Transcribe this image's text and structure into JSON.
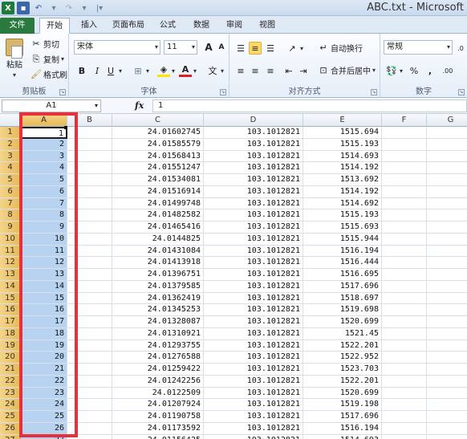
{
  "window": {
    "title": "ABC.txt - Microsoft"
  },
  "ribbon": {
    "tabs": [
      "文件",
      "开始",
      "插入",
      "页面布局",
      "公式",
      "数据",
      "审阅",
      "视图"
    ],
    "active_tab": "开始",
    "clipboard": {
      "paste": "粘贴",
      "cut": "剪切",
      "copy": "复制",
      "format_painter": "格式刷",
      "label": "剪贴板"
    },
    "font": {
      "name": "宋体",
      "size": "11",
      "bold": "B",
      "italic": "I",
      "underline": "U",
      "grow": "A",
      "shrink": "A",
      "font_color": "A",
      "phonetic": "文",
      "label": "字体"
    },
    "alignment": {
      "wrap_text": "自动换行",
      "merge_center": "合并后居中",
      "label": "对齐方式"
    },
    "number": {
      "format": "常规",
      "percent": "%",
      "comma": ",",
      "label": "数字"
    }
  },
  "formula_bar": {
    "name_box": "A1",
    "fx": "fx",
    "value": "1"
  },
  "grid": {
    "columns": [
      "A",
      "B",
      "C",
      "D",
      "E",
      "F",
      "G"
    ],
    "selected_column": "A",
    "active_cell": "A1",
    "rows": [
      [
        "1",
        "1",
        "",
        "24.01602745",
        "103.1012821",
        "1515.694"
      ],
      [
        "2",
        "2",
        "",
        "24.01585579",
        "103.1012821",
        "1515.193"
      ],
      [
        "3",
        "3",
        "",
        "24.01568413",
        "103.1012821",
        "1514.693"
      ],
      [
        "4",
        "4",
        "",
        "24.01551247",
        "103.1012821",
        "1514.192"
      ],
      [
        "5",
        "5",
        "",
        "24.01534081",
        "103.1012821",
        "1513.692"
      ],
      [
        "6",
        "6",
        "",
        "24.01516914",
        "103.1012821",
        "1514.192"
      ],
      [
        "7",
        "7",
        "",
        "24.01499748",
        "103.1012821",
        "1514.692"
      ],
      [
        "8",
        "8",
        "",
        "24.01482582",
        "103.1012821",
        "1515.193"
      ],
      [
        "9",
        "9",
        "",
        "24.01465416",
        "103.1012821",
        "1515.693"
      ],
      [
        "10",
        "10",
        "",
        "24.0144825",
        "103.1012821",
        "1515.944"
      ],
      [
        "11",
        "11",
        "",
        "24.01431084",
        "103.1012821",
        "1516.194"
      ],
      [
        "12",
        "12",
        "",
        "24.01413918",
        "103.1012821",
        "1516.444"
      ],
      [
        "13",
        "13",
        "",
        "24.01396751",
        "103.1012821",
        "1516.695"
      ],
      [
        "14",
        "14",
        "",
        "24.01379585",
        "103.1012821",
        "1517.696"
      ],
      [
        "15",
        "15",
        "",
        "24.01362419",
        "103.1012821",
        "1518.697"
      ],
      [
        "16",
        "16",
        "",
        "24.01345253",
        "103.1012821",
        "1519.698"
      ],
      [
        "17",
        "17",
        "",
        "24.01328087",
        "103.1012821",
        "1520.699"
      ],
      [
        "18",
        "18",
        "",
        "24.01310921",
        "103.1012821",
        "1521.45"
      ],
      [
        "19",
        "19",
        "",
        "24.01293755",
        "103.1012821",
        "1522.201"
      ],
      [
        "20",
        "20",
        "",
        "24.01276588",
        "103.1012821",
        "1522.952"
      ],
      [
        "21",
        "21",
        "",
        "24.01259422",
        "103.1012821",
        "1523.703"
      ],
      [
        "22",
        "22",
        "",
        "24.01242256",
        "103.1012821",
        "1522.201"
      ],
      [
        "23",
        "23",
        "",
        "24.0122509",
        "103.1012821",
        "1520.699"
      ],
      [
        "24",
        "24",
        "",
        "24.01207924",
        "103.1012821",
        "1519.198"
      ],
      [
        "25",
        "25",
        "",
        "24.01190758",
        "103.1012821",
        "1517.696"
      ],
      [
        "26",
        "26",
        "",
        "24.01173592",
        "103.1012821",
        "1516.194"
      ],
      [
        "27",
        "27",
        "",
        "24.01156425",
        "103.1012821",
        "1514.693"
      ]
    ]
  },
  "colors": {
    "selection_fill": "#b7d3f0",
    "header_selected": "#e8b957",
    "highlight_box": "#e8303a",
    "file_tab": "#2a7a3f"
  }
}
